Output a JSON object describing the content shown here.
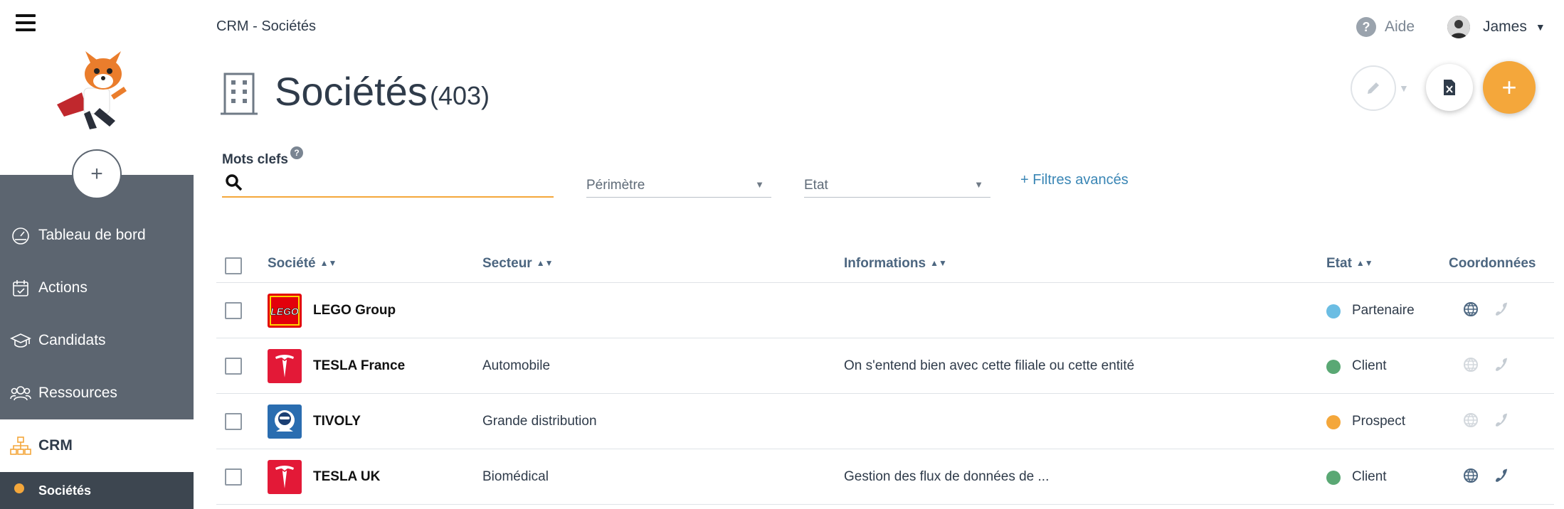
{
  "breadcrumb": "CRM - Sociétés",
  "header": {
    "help_label": "Aide",
    "user_name": "James"
  },
  "page": {
    "title": "Sociétés",
    "count": "(403)"
  },
  "sidebar": {
    "items": [
      {
        "label": "Tableau de bord",
        "icon": "dashboard-icon"
      },
      {
        "label": "Actions",
        "icon": "calendar-check-icon"
      },
      {
        "label": "Candidats",
        "icon": "graduation-cap-icon"
      },
      {
        "label": "Ressources",
        "icon": "users-icon"
      },
      {
        "label": "CRM",
        "icon": "org-chart-icon"
      }
    ],
    "sub_item": "Sociétés"
  },
  "filters": {
    "keywords_label": "Mots clefs",
    "keywords_value": "",
    "perimeter": "Périmètre",
    "state": "Etat",
    "advanced": "+ Filtres avancés"
  },
  "table": {
    "headers": [
      "Société",
      "Secteur",
      "Informations",
      "Etat",
      "Coordonnées"
    ],
    "rows": [
      {
        "name": "LEGO Group",
        "sector": "",
        "info": "",
        "state": "Partenaire",
        "state_color": "#6bbde3",
        "logo": "lego-logo",
        "web_active": true,
        "phone_active": false
      },
      {
        "name": "TESLA France",
        "sector": "Automobile",
        "info": "On s'entend bien avec cette filiale ou cette entité",
        "state": "Client",
        "state_color": "#5aa874",
        "logo": "tesla-logo",
        "web_active": false,
        "phone_active": false
      },
      {
        "name": "TIVOLY",
        "sector": "Grande distribution",
        "info": "",
        "state": "Prospect",
        "state_color": "#f4a73b",
        "logo": "tivoly-logo",
        "web_active": false,
        "phone_active": false
      },
      {
        "name": "TESLA UK",
        "sector": "Biomédical",
        "info": "Gestion des flux de données de ...",
        "state": "Client",
        "state_color": "#5aa874",
        "logo": "tesla-logo",
        "web_active": true,
        "phone_active": true
      }
    ]
  },
  "colors": {
    "accent": "#f4a73b",
    "sidebar": "#5c6570",
    "link": "#3a86b5"
  }
}
